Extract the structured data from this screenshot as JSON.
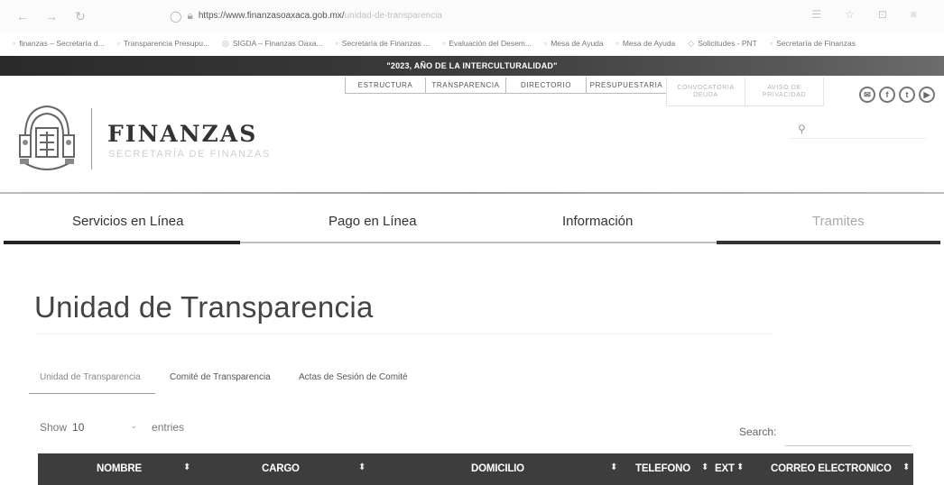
{
  "browser": {
    "url_domain": "https://www.finanzasoaxaca.gob.mx/",
    "url_path": "unidad-de-transparencia"
  },
  "bookmarks": [
    {
      "label": "finanzas – Secretaría d..."
    },
    {
      "label": "Transparencia Presupu..."
    },
    {
      "label": "SIGDA – Finanzas Oaxa..."
    },
    {
      "label": "Secretaría de Finanzas ..."
    },
    {
      "label": "Evaluación del Desem..."
    },
    {
      "label": "Mesa de Ayuda"
    },
    {
      "label": "Mesa de Ayuda"
    },
    {
      "label": "Solicitudes - PNT"
    },
    {
      "label": "Secretaría de Finanzas"
    }
  ],
  "banner": {
    "text": "\"2023, AÑO DE LA INTERCULTURALIDAD\""
  },
  "header": {
    "top_links": [
      "ESTRUCTURA",
      "TRANSPARENCIA",
      "DIRECTORIO",
      "PRESUPUESTARIA"
    ],
    "top_links_faded": [
      "CONVOCATORIA DEUDA",
      "AVISO DE PRIVACIDAD"
    ],
    "brand_title": "FINANZAS",
    "brand_subtitle": "SECRETARÍA DE FINANZAS",
    "social_icons": [
      "mail-icon",
      "facebook-icon",
      "twitter-icon",
      "youtube-icon"
    ]
  },
  "main_nav": {
    "items": [
      "Servicios en Línea",
      "Pago en Línea",
      "Información",
      "Tramites"
    ]
  },
  "page": {
    "title": "Unidad de Transparencia",
    "tabs": [
      "Unidad de Transparencia",
      "Comité de Transparencia",
      "Actas de Sesión de Comité"
    ]
  },
  "table": {
    "show_label": "Show",
    "show_value": "10",
    "entries_label": "entries",
    "search_label": "Search:",
    "columns": [
      "NOMBRE",
      "CARGO",
      "DOMICILIO",
      "TELEFONO",
      "EXT",
      "CORREO ELECTRONICO"
    ]
  },
  "colors": {
    "banner": "#333333",
    "table_header": "#3d3d3d",
    "nav_active_bar": "#333333"
  }
}
